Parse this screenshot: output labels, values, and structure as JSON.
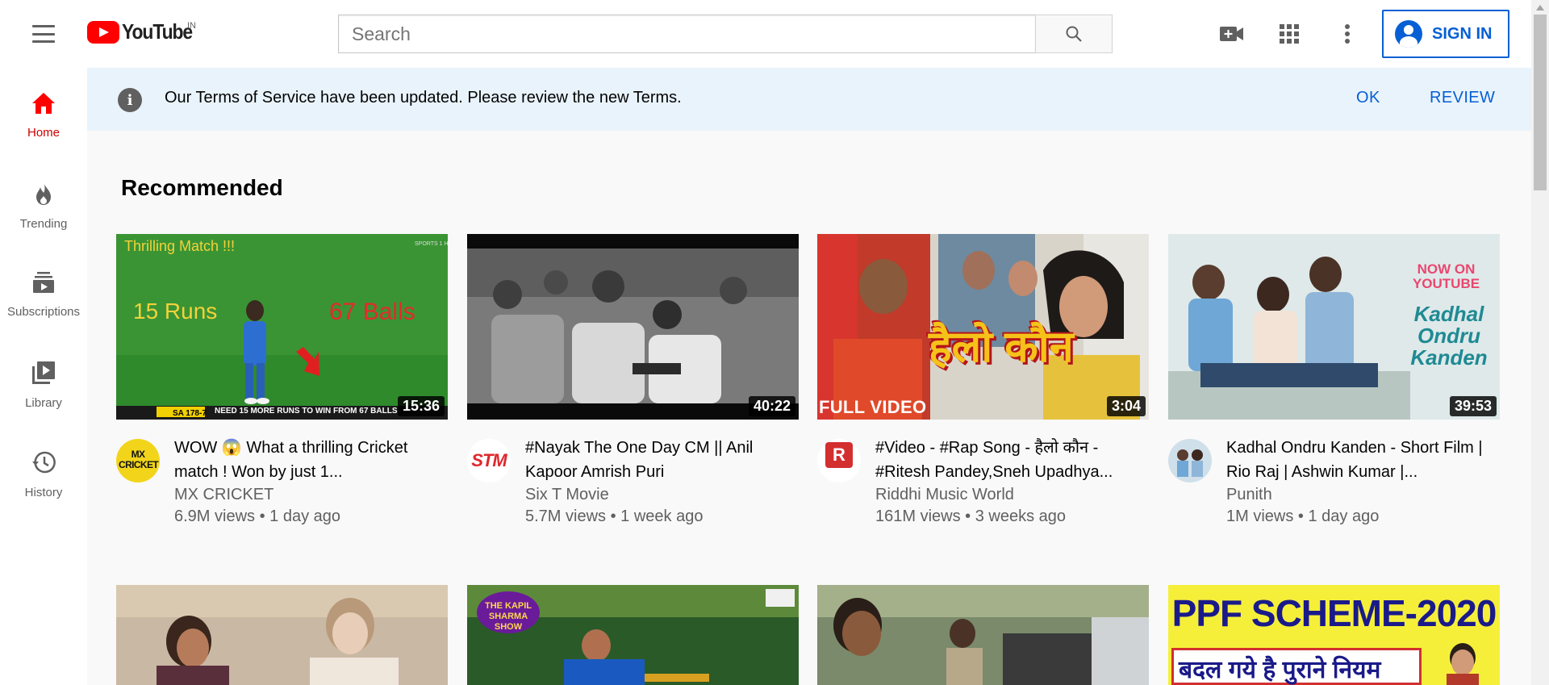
{
  "header": {
    "logo_text": "YouTube",
    "country_code": "IN",
    "search_placeholder": "Search",
    "signin_label": "SIGN IN"
  },
  "sidebar": {
    "items": [
      {
        "label": "Home",
        "icon": "home-icon",
        "active": true
      },
      {
        "label": "Trending",
        "icon": "fire-icon"
      },
      {
        "label": "Subscriptions",
        "icon": "subscriptions-icon"
      },
      {
        "label": "Library",
        "icon": "library-icon"
      },
      {
        "label": "History",
        "icon": "history-icon"
      }
    ]
  },
  "banner": {
    "text": "Our Terms of Service have been updated. Please review the new Terms.",
    "ok_label": "OK",
    "review_label": "REVIEW"
  },
  "main": {
    "section_title": "Recommended",
    "videos": [
      {
        "title": "WOW 😱 What a thrilling Cricket match ! Won by just 1...",
        "channel": "MX CRICKET",
        "meta": "6.9M views • 1 day ago",
        "duration": "15:36",
        "thumb_text_1": "Thrilling Match !!!",
        "thumb_text_2": "15 Runs",
        "thumb_text_3": "67 Balls",
        "thumb_ticker": "NEED 15 MORE RUNS TO WIN FROM 67 BALLS",
        "avatar_text": "MX CRICKET"
      },
      {
        "title": "#Nayak The One Day CM || Anil Kapoor Amrish Puri",
        "channel": "Six T Movie",
        "meta": "5.7M views • 1 week ago",
        "duration": "40:22",
        "avatar_text": "STM"
      },
      {
        "title": "#Video - #Rap Song - हैलो कौन - #Ritesh Pandey,Sneh Upadhya...",
        "channel": "Riddhi Music World",
        "meta": "161M views • 3 weeks ago",
        "duration": "3:04",
        "thumb_text_1": "FULL VIDEO",
        "thumb_text_2": "हैलो कौन",
        "avatar_text": "R"
      },
      {
        "title": "Kadhal Ondru Kanden - Short Film | Rio Raj | Ashwin Kumar |...",
        "channel": "Punith",
        "meta": "1M views • 1 day ago",
        "duration": "39:53",
        "thumb_text_1": "NOW ON YOUTUBE",
        "thumb_text_2": "Kadhal Ondru Kanden"
      }
    ],
    "row2": {
      "thumb_text_2": "THE KAPIL SHARMA SHOW",
      "thumb_text_4a": "PPF SCHEME-2020",
      "thumb_text_4b": "बदल गये है पुराने नियम"
    }
  },
  "colors": {
    "brand_red": "#ff0000",
    "link_blue": "#065fd4",
    "banner_bg": "#e9f3fb"
  }
}
